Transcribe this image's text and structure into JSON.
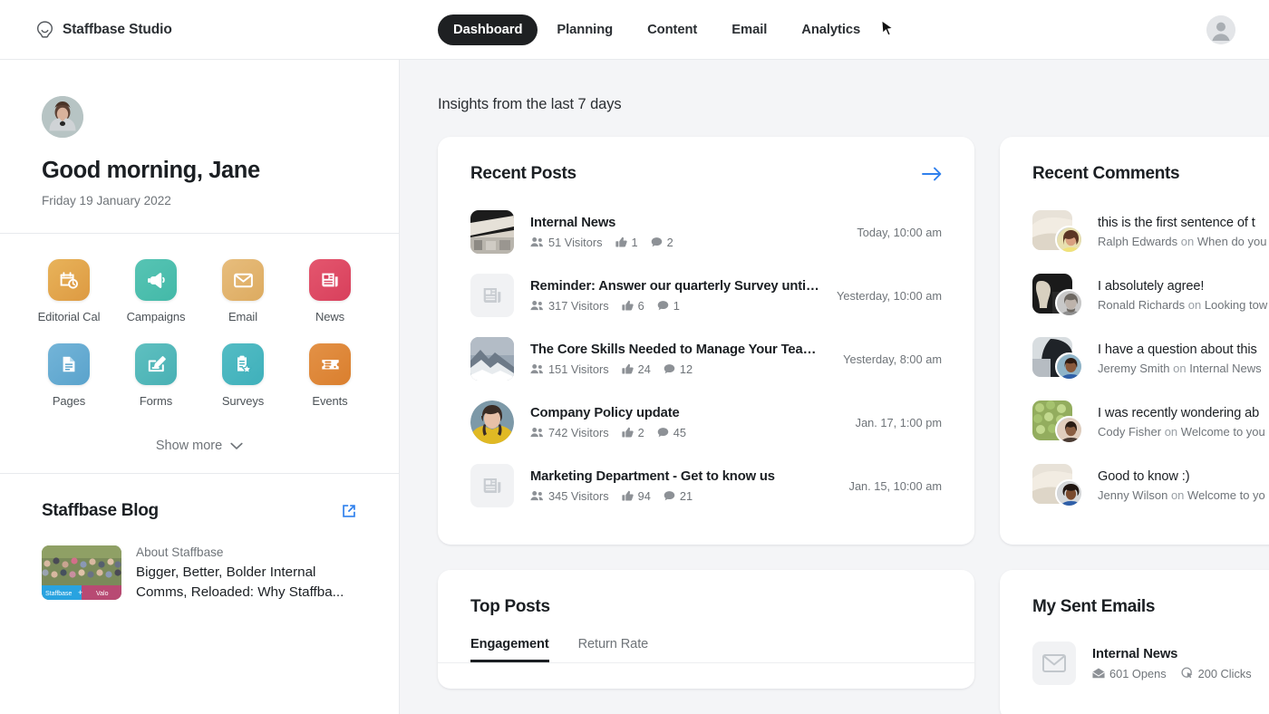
{
  "topbar": {
    "brand": "Staffbase Studio",
    "brand_icon": "staffbase-logo-icon",
    "tabs": [
      {
        "label": "Dashboard",
        "active": true
      },
      {
        "label": "Planning",
        "active": false
      },
      {
        "label": "Content",
        "active": false
      },
      {
        "label": "Email",
        "active": false
      },
      {
        "label": "Analytics",
        "active": false
      }
    ],
    "avatar_icon": "user-avatar-icon"
  },
  "sidebar": {
    "greeting": "Good morning, Jane",
    "date": "Friday 19 January 2022",
    "apps": [
      {
        "label": "Editorial Cal",
        "icon": "calendar-clock-icon",
        "color": "#e3a councils"
      },
      {
        "label": "Campaigns",
        "icon": "megaphone-icon"
      },
      {
        "label": "Email",
        "icon": "envelope-icon"
      },
      {
        "label": "News",
        "icon": "newspaper-icon"
      },
      {
        "label": "Pages",
        "icon": "document-icon"
      },
      {
        "label": "Forms",
        "icon": "form-pencil-icon"
      },
      {
        "label": "Surveys",
        "icon": "clipboard-star-icon"
      },
      {
        "label": "Events",
        "icon": "ticket-icon"
      }
    ],
    "show_more": "Show more",
    "show_more_icon": "chevron-down-icon",
    "blog": {
      "title": "Staffbase Blog",
      "external_icon": "external-link-icon",
      "item": {
        "kicker": "About Staffbase",
        "headline": "Bigger, Better, Bolder Internal Comms, Reloaded: Why Staffba..."
      }
    }
  },
  "main": {
    "insights_title": "Insights from the last 7 days",
    "recent_posts": {
      "title": "Recent Posts",
      "arrow_icon": "arrow-right-icon",
      "items": [
        {
          "title": "Internal News",
          "visitors": "51 Visitors",
          "likes": "1",
          "comments": "2",
          "time": "Today, 10:00 am",
          "thumb": "office-photo"
        },
        {
          "title": "Reminder: Answer our quarterly Survey until tomorrow!",
          "visitors": "317 Visitors",
          "likes": "6",
          "comments": "1",
          "time": "Yesterday, 10:00 am",
          "thumb": "placeholder-news"
        },
        {
          "title": "The Core Skills Needed to Manage Your Team ...",
          "visitors": "151 Visitors",
          "likes": "24",
          "comments": "12",
          "time": "Yesterday, 8:00 am",
          "thumb": "mountain-photo"
        },
        {
          "title": "Company Policy update",
          "visitors": "742 Visitors",
          "likes": "2",
          "comments": "45",
          "time": "Jan. 17, 1:00 pm",
          "thumb": "person-photo"
        },
        {
          "title": "Marketing Department - Get to know us",
          "visitors": "345 Visitors",
          "likes": "94",
          "comments": "21",
          "time": "Jan. 15, 10:00 am",
          "thumb": "placeholder-news"
        }
      ],
      "visitors_icon": "people-icon",
      "likes_icon": "thumbs-up-icon",
      "comments_icon": "comment-bubble-icon"
    },
    "recent_comments": {
      "title": "Recent Comments",
      "items": [
        {
          "text": "this is the first sentence of t",
          "author": "Ralph Edwards",
          "on": "on",
          "post": "When do you"
        },
        {
          "text": "I absolutely agree!",
          "author": "Ronald Richards",
          "on": "on",
          "post": "Looking tow"
        },
        {
          "text": "I have a question about this",
          "author": "Jeremy Smith",
          "on": "on",
          "post": "Internal News"
        },
        {
          "text": "I was recently wondering ab",
          "author": "Cody Fisher",
          "on": "on",
          "post": "Welcome to you"
        },
        {
          "text": "Good to know :)",
          "author": "Jenny Wilson",
          "on": "on",
          "post": "Welcome to yo"
        }
      ]
    },
    "top_posts": {
      "title": "Top Posts",
      "tabs": [
        {
          "label": "Engagement",
          "active": true
        },
        {
          "label": "Return Rate",
          "active": false
        }
      ]
    },
    "sent_emails": {
      "title": "My Sent Emails",
      "items": [
        {
          "title": "Internal News",
          "opens": "601 Opens",
          "clicks": "200 Clicks"
        }
      ],
      "mail_icon": "envelope-icon",
      "opens_icon": "mail-open-icon",
      "clicks_icon": "click-cursor-icon"
    }
  },
  "colors": {
    "accent_blue": "#2f80ed",
    "background": "#f4f5f7",
    "card": "#ffffff",
    "text_primary": "#1b1f23",
    "text_secondary": "#6f7479",
    "tab_active_bg": "#1e2022"
  }
}
